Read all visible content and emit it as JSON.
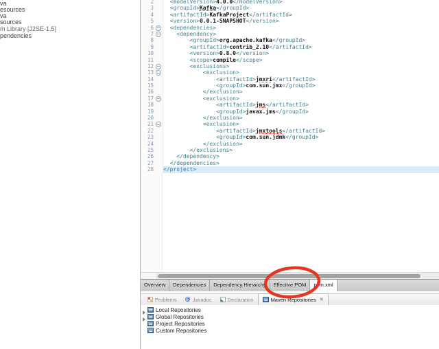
{
  "explorer": {
    "items": [
      {
        "label": "va",
        "dim": false
      },
      {
        "label": "esources",
        "dim": false
      },
      {
        "label": "va",
        "dim": false
      },
      {
        "label": "sources",
        "dim": false
      },
      {
        "label": "m Library [J2SE-1.5]",
        "dim": true
      },
      {
        "label": "pendencies",
        "dim": false
      }
    ]
  },
  "editor": {
    "code_lines": [
      {
        "n": "2",
        "fold": false,
        "hl": false,
        "parts": [
          {
            "t": "tag",
            "s": "  <modelVersion>"
          },
          {
            "t": "txt",
            "s": "4.0.0"
          },
          {
            "t": "tag",
            "s": "</modelVersion>"
          }
        ]
      },
      {
        "n": "3",
        "fold": false,
        "hl": false,
        "parts": [
          {
            "t": "tag",
            "s": "  <groupId>"
          },
          {
            "t": "warn",
            "s": "Kafka"
          },
          {
            "t": "tag",
            "s": "</groupId>"
          }
        ]
      },
      {
        "n": "4",
        "fold": false,
        "hl": false,
        "parts": [
          {
            "t": "tag",
            "s": "  <artifactId>"
          },
          {
            "t": "txt",
            "s": "KafkaProject"
          },
          {
            "t": "tag",
            "s": "</artifactId>"
          }
        ]
      },
      {
        "n": "5",
        "fold": false,
        "hl": false,
        "parts": [
          {
            "t": "tag",
            "s": "  <version>"
          },
          {
            "t": "txt",
            "s": "0.0.1-SNAPSHOT"
          },
          {
            "t": "tag",
            "s": "</version>"
          }
        ]
      },
      {
        "n": "6",
        "fold": true,
        "hl": false,
        "parts": [
          {
            "t": "tag",
            "s": "  <dependencies>"
          }
        ]
      },
      {
        "n": "7",
        "fold": true,
        "hl": false,
        "parts": [
          {
            "t": "tag",
            "s": "    <dependency>"
          }
        ]
      },
      {
        "n": "8",
        "fold": false,
        "hl": false,
        "parts": [
          {
            "t": "tag",
            "s": "        <groupId>"
          },
          {
            "t": "txt",
            "s": "org.apache.kafka"
          },
          {
            "t": "tag",
            "s": "</groupId>"
          }
        ]
      },
      {
        "n": "9",
        "fold": false,
        "hl": false,
        "parts": [
          {
            "t": "tag",
            "s": "        <artifactId>"
          },
          {
            "t": "txt",
            "s": "contrib_2.10"
          },
          {
            "t": "tag",
            "s": "</artifactId>"
          }
        ]
      },
      {
        "n": "10",
        "fold": false,
        "hl": false,
        "parts": [
          {
            "t": "tag",
            "s": "        <version>"
          },
          {
            "t": "txt",
            "s": "0.8.0"
          },
          {
            "t": "tag",
            "s": "</version>"
          }
        ]
      },
      {
        "n": "11",
        "fold": false,
        "hl": false,
        "parts": [
          {
            "t": "tag",
            "s": "        <scope>"
          },
          {
            "t": "txt",
            "s": "compile"
          },
          {
            "t": "tag",
            "s": "</scope>"
          }
        ]
      },
      {
        "n": "12",
        "fold": true,
        "hl": false,
        "parts": [
          {
            "t": "tag",
            "s": "        <exclusions>"
          }
        ]
      },
      {
        "n": "13",
        "fold": true,
        "hl": false,
        "parts": [
          {
            "t": "tag",
            "s": "            <exclusion>"
          }
        ]
      },
      {
        "n": "14",
        "fold": false,
        "hl": false,
        "parts": [
          {
            "t": "tag",
            "s": "                <artifactId>"
          },
          {
            "t": "warn",
            "s": "jmxri"
          },
          {
            "t": "tag",
            "s": "</artifactId>"
          }
        ]
      },
      {
        "n": "15",
        "fold": false,
        "hl": false,
        "parts": [
          {
            "t": "tag",
            "s": "                <groupId>"
          },
          {
            "t": "txt",
            "s": "com.sun.jmx"
          },
          {
            "t": "tag",
            "s": "</groupId>"
          }
        ]
      },
      {
        "n": "16",
        "fold": false,
        "hl": false,
        "parts": [
          {
            "t": "tag",
            "s": "            </exclusion>"
          }
        ]
      },
      {
        "n": "17",
        "fold": true,
        "hl": false,
        "parts": [
          {
            "t": "tag",
            "s": "            <exclusion>"
          }
        ]
      },
      {
        "n": "18",
        "fold": false,
        "hl": false,
        "parts": [
          {
            "t": "tag",
            "s": "                <artifactId>"
          },
          {
            "t": "warn",
            "s": "jms"
          },
          {
            "t": "tag",
            "s": "</artifactId>"
          }
        ]
      },
      {
        "n": "19",
        "fold": false,
        "hl": false,
        "parts": [
          {
            "t": "tag",
            "s": "                <groupId>"
          },
          {
            "t": "txt",
            "s": "javax.jms"
          },
          {
            "t": "tag",
            "s": "</groupId>"
          }
        ]
      },
      {
        "n": "20",
        "fold": false,
        "hl": false,
        "parts": [
          {
            "t": "tag",
            "s": "            </exclusion>"
          }
        ]
      },
      {
        "n": "21",
        "fold": true,
        "hl": false,
        "parts": [
          {
            "t": "tag",
            "s": "            <exclusion>"
          }
        ]
      },
      {
        "n": "22",
        "fold": false,
        "hl": false,
        "parts": [
          {
            "t": "tag",
            "s": "                <artifactId>"
          },
          {
            "t": "warn",
            "s": "jmxtools"
          },
          {
            "t": "tag",
            "s": "</artifactId>"
          }
        ]
      },
      {
        "n": "23",
        "fold": false,
        "hl": false,
        "parts": [
          {
            "t": "tag",
            "s": "                <groupId>"
          },
          {
            "t": "txt",
            "s": "com.sun.jdmk"
          },
          {
            "t": "tag",
            "s": "</groupId>"
          }
        ]
      },
      {
        "n": "24",
        "fold": false,
        "hl": false,
        "parts": [
          {
            "t": "tag",
            "s": "            </exclusion>"
          }
        ]
      },
      {
        "n": "25",
        "fold": false,
        "hl": false,
        "parts": [
          {
            "t": "tag",
            "s": "        </exclusions>"
          }
        ]
      },
      {
        "n": "26",
        "fold": false,
        "hl": false,
        "parts": [
          {
            "t": "tag",
            "s": "    </dependency>"
          }
        ]
      },
      {
        "n": "27",
        "fold": false,
        "hl": false,
        "parts": [
          {
            "t": "tag",
            "s": "  </dependencies>"
          }
        ]
      },
      {
        "n": "28",
        "fold": false,
        "hl": true,
        "parts": [
          {
            "t": "tag",
            "s": "</project>"
          }
        ]
      }
    ],
    "page_tabs": {
      "items": [
        "Overview",
        "Dependencies",
        "Dependency Hierarchy",
        "Effective POM",
        "pom.xml"
      ],
      "selected": "pom.xml"
    }
  },
  "views": {
    "tabs": [
      {
        "label": "Problems",
        "icon": "problems",
        "selected": false
      },
      {
        "label": "Javadoc",
        "icon": "javadoc",
        "selected": false
      },
      {
        "label": "Declaration",
        "icon": "declaration",
        "selected": false
      },
      {
        "label": "Maven Repositories",
        "icon": "mavenrepo",
        "selected": true
      }
    ],
    "close_glyph": "✕"
  },
  "repositories": {
    "items": [
      {
        "label": "Local Repositories",
        "expandable": true
      },
      {
        "label": "Global Repositories",
        "expandable": true
      },
      {
        "label": "Project Repositories",
        "expandable": false
      },
      {
        "label": "Custom Repositories",
        "expandable": false
      }
    ]
  },
  "annotation": {
    "type": "ellipse",
    "target": "pom.xml tab",
    "color": "#e43722"
  },
  "colors": {
    "tag": "#3f7f8f",
    "content_text": "#101010",
    "line_number": "#8b97a5",
    "current_line_highlight": "#d9ecfc",
    "warn_underline": "#cf3b2a",
    "annotation_red": "#e43722"
  }
}
